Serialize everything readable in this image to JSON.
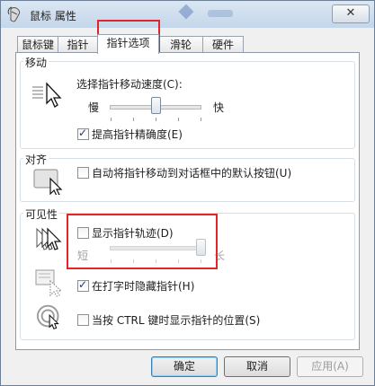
{
  "window": {
    "title": "鼠标 属性",
    "close_label": "✕"
  },
  "tabs": [
    {
      "label": "鼠标键",
      "active": false
    },
    {
      "label": "指针",
      "active": false
    },
    {
      "label": "指针选项",
      "active": true
    },
    {
      "label": "滑轮",
      "active": false
    },
    {
      "label": "硬件",
      "active": false
    }
  ],
  "motion": {
    "group_label": "移动",
    "speed_label": "选择指针移动速度(C):",
    "slow_label": "慢",
    "fast_label": "快",
    "speed_level": 0.5,
    "precision_label": "提高指针精确度(E)",
    "precision_checked": true
  },
  "snap": {
    "group_label": "对齐",
    "snap_label": "自动将指针移动到对话框中的默认按钮(U)",
    "snap_checked": false
  },
  "visibility": {
    "group_label": "可见性",
    "trails_label": "显示指针轨迹(D)",
    "trails_checked": false,
    "short_label": "短",
    "long_label": "长",
    "trail_level": 1.0,
    "hide_label": "在打字时隐藏指针(H)",
    "hide_checked": true,
    "ctrl_label": "当按 CTRL 键时显示指针的位置(S)",
    "ctrl_checked": false
  },
  "buttons": {
    "ok": "确定",
    "cancel": "取消",
    "apply": "应用(A)"
  }
}
